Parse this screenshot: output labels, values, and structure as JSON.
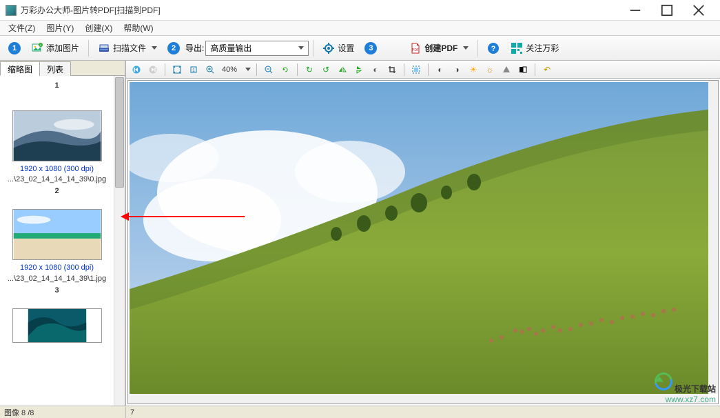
{
  "window": {
    "title": "万彩办公大师-图片转PDF[扫描到PDF]"
  },
  "menubar": {
    "file": "文件(Z)",
    "image": "图片(Y)",
    "create": "创建(X)",
    "help": "帮助(W)"
  },
  "toolbar": {
    "step1": "1",
    "add_image": "添加图片",
    "scan_file": "扫描文件",
    "step2": "2",
    "export_label": "导出:",
    "export_combo": "高质量输出",
    "settings": "设置",
    "step3": "3",
    "create_pdf": "创建PDF",
    "about": "关注万彩"
  },
  "left_tabs": {
    "thumb": "缩略图",
    "list": "列表"
  },
  "thumbs": [
    {
      "num": "1",
      "caption": "1920 x 1080 (300 dpi)",
      "path": "...\\23_02_14_14_14_39\\0.jpg"
    },
    {
      "num": "2",
      "caption": "1920 x 1080 (300 dpi)",
      "path": "...\\23_02_14_14_14_39\\1.jpg"
    },
    {
      "num": "3",
      "caption": "",
      "path": ""
    }
  ],
  "img_toolbar": {
    "zoom": "40%"
  },
  "status": {
    "left": "图像 8 /8",
    "main": "7"
  },
  "watermark": {
    "cn": "极光下载站",
    "url": "www.xz7.com"
  }
}
